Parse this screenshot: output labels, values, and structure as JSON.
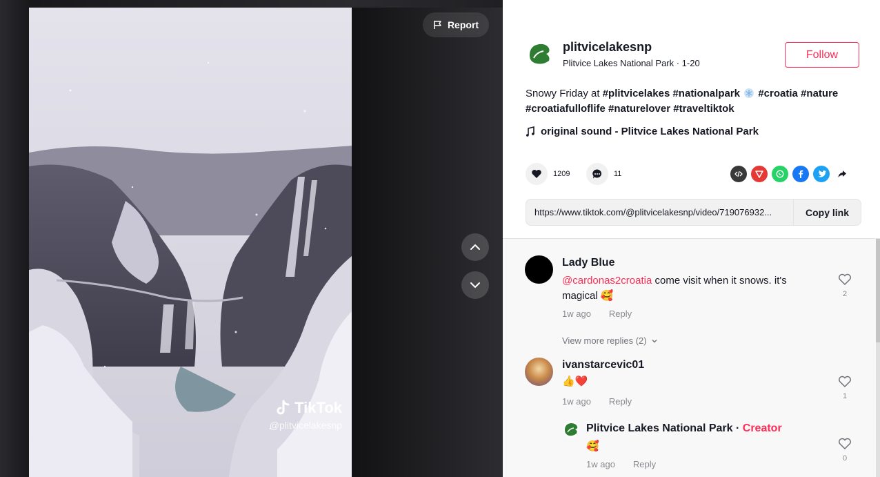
{
  "video": {
    "report_label": "Report",
    "watermark_brand": "TikTok",
    "watermark_handle": "@plitvicelakesnp"
  },
  "author": {
    "username": "plitvicelakesnp",
    "subtitle": "Plitvice Lakes National Park · 1-20",
    "follow_label": "Follow"
  },
  "caption": {
    "prefix": "Snowy Friday at ",
    "tag1": "#plitvicelakes",
    "tag2": "#nationalpark",
    "tag3": "#croatia",
    "tag4": "#nature",
    "tag5": "#croatiafulloflife",
    "tag6": "#naturelover",
    "tag7": "#traveltiktok"
  },
  "sound": {
    "label": "original sound - Plitvice Lakes National Park"
  },
  "stats": {
    "likes": "1209",
    "comments": "11"
  },
  "share_icons": [
    "embed-icon",
    "send-icon",
    "whatsapp-icon",
    "facebook-icon",
    "twitter-icon",
    "share-arrow-icon"
  ],
  "link": {
    "url": "https://www.tiktok.com/@plitvicelakesnp/video/719076932...",
    "copy_label": "Copy link"
  },
  "comments": [
    {
      "name": "Lady Blue",
      "mention": "@cardonas2croatia",
      "text": " come visit when it snows. it's magical",
      "emoji": "🥰",
      "time": "1w ago",
      "reply_label": "Reply",
      "likes": "2",
      "more_replies": "View more replies (2)"
    },
    {
      "name": "ivanstarcevic01",
      "text": "👍❤️",
      "time": "1w ago",
      "reply_label": "Reply",
      "likes": "1"
    },
    {
      "name": "Plitvice Lakes National Park",
      "separator": " · ",
      "creator_label": "Creator",
      "text": "🥰",
      "time": "1w ago",
      "reply_label": "Reply",
      "likes": "0"
    }
  ],
  "colors": {
    "accent": "#fe2c55",
    "whatsapp": "#25d366",
    "facebook": "#1877f2",
    "twitter": "#1da1f2",
    "send": "#e53935",
    "embed": "#393939"
  }
}
